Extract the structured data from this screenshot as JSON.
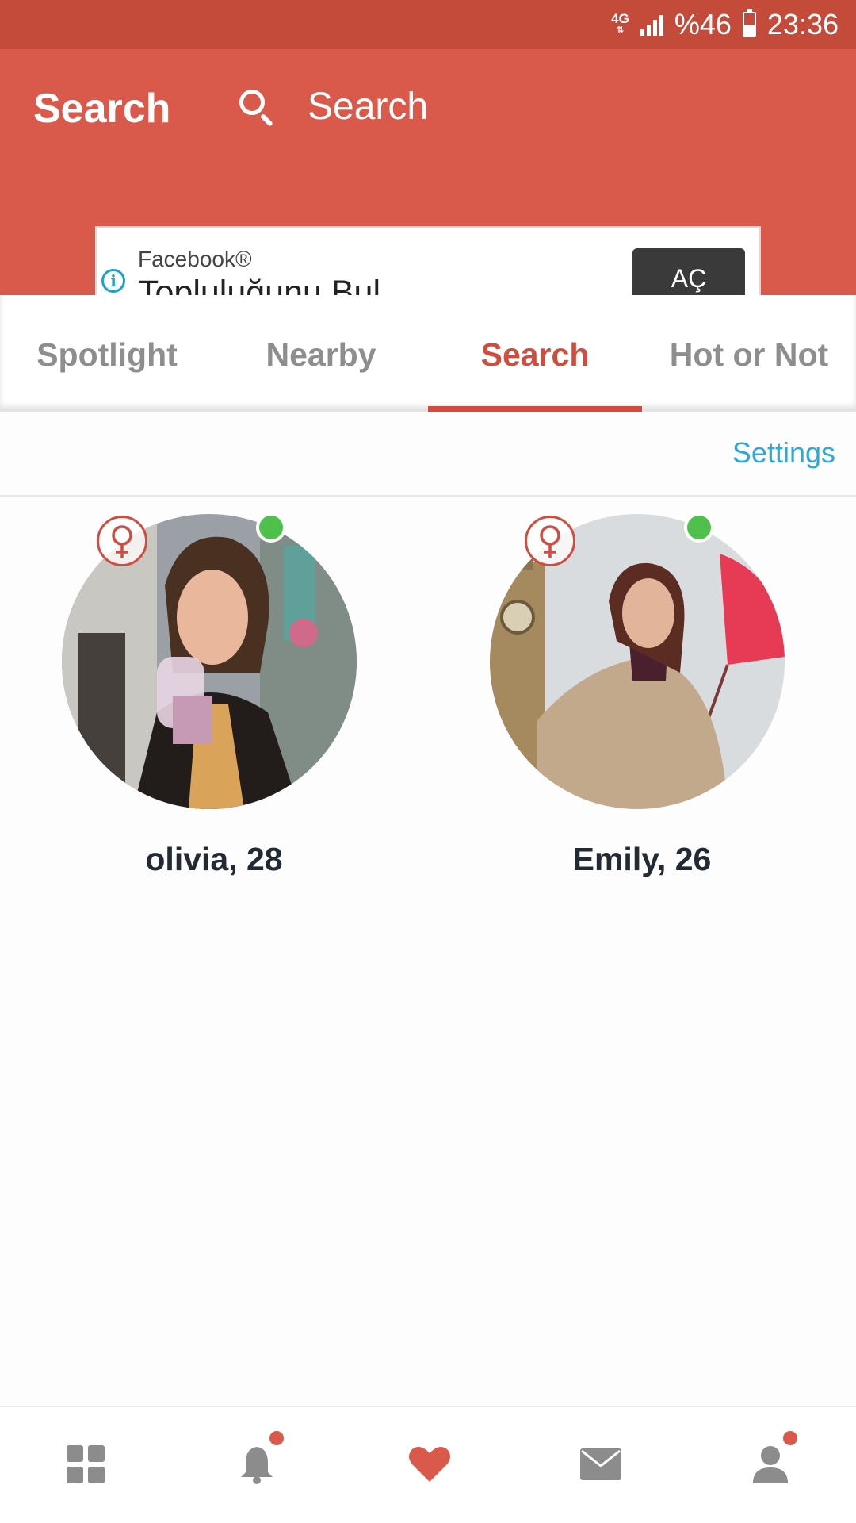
{
  "status_bar": {
    "network": "4G",
    "battery_percent": "%46",
    "battery_level": 0.46,
    "time": "23:36"
  },
  "header": {
    "title": "Search",
    "search_placeholder": "Search"
  },
  "ad": {
    "brand": "Facebook®",
    "headline": "Topluluğunu Bul",
    "cta": "AÇ"
  },
  "tabs": [
    {
      "label": "Spotlight",
      "active": false
    },
    {
      "label": "Nearby",
      "active": false
    },
    {
      "label": "Search",
      "active": true
    },
    {
      "label": "Hot or Not",
      "active": false
    }
  ],
  "settings_label": "Settings",
  "profiles": [
    {
      "name": "olivia, 28",
      "gender_icon": "female-icon",
      "online": true
    },
    {
      "name": "Emily, 26",
      "gender_icon": "female-icon",
      "online": true
    }
  ],
  "bottom_nav": [
    {
      "icon": "grid-icon",
      "active": false,
      "badge": false
    },
    {
      "icon": "bell-icon",
      "active": false,
      "badge": true
    },
    {
      "icon": "heart-icon",
      "active": true,
      "badge": false
    },
    {
      "icon": "mail-icon",
      "active": false,
      "badge": false
    },
    {
      "icon": "profile-icon",
      "active": false,
      "badge": true
    }
  ],
  "colors": {
    "brand": "#d9594a",
    "status_bar": "#c44a3a",
    "online": "#4fc04b",
    "link": "#2fa8d8",
    "nav_inactive": "#8c8c8c"
  }
}
